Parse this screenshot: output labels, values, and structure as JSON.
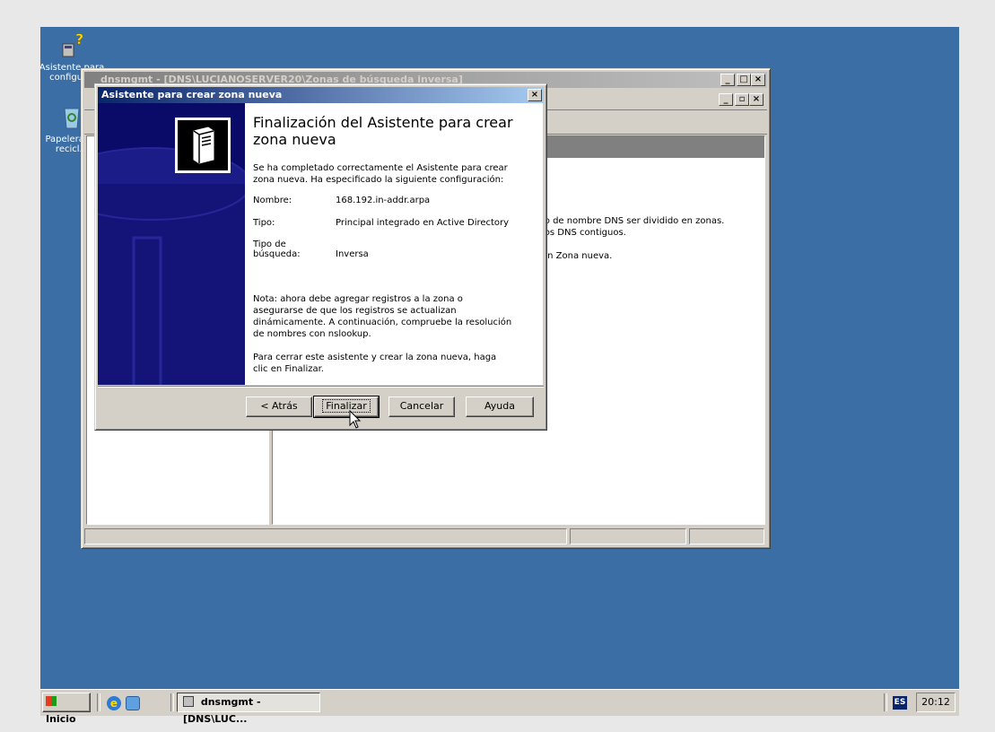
{
  "desktop": {
    "icons": [
      {
        "label": "Asistente para configur...",
        "icon": "wizard-icon"
      },
      {
        "label": "Papelera de recicl...",
        "icon": "recycle-bin-icon"
      }
    ]
  },
  "mmc": {
    "title": "dnsmgmt - [DNS\\LUCIANOSERVER20\\Zonas de búsqueda inversa]",
    "right_text": [
      "io de nombre DNS ser dividido en zonas.",
      "ios DNS contiguos.",
      "en Zona nueva."
    ]
  },
  "wizard": {
    "title": "Asistente para crear zona nueva",
    "heading": "Finalización del Asistente para crear zona nueva",
    "intro": "Se ha completado correctamente el Asistente para crear zona nueva. Ha especificado la siguiente configuración:",
    "fields": [
      {
        "label": "Nombre:",
        "value": "168.192.in-addr.arpa"
      },
      {
        "label": "Tipo:",
        "value": "Principal integrado en Active Directory"
      },
      {
        "label": "Tipo de búsqueda:",
        "value": "Inversa"
      }
    ],
    "note": "Nota: ahora debe agregar registros a la zona o asegurarse de que los registros se actualizan dinámicamente. A continuación, compruebe la resolución de nombres con nslookup.",
    "closing": "Para cerrar este asistente y crear la zona nueva, haga clic en Finalizar.",
    "buttons": {
      "back": "< Atrás",
      "finish": "Finalizar",
      "cancel": "Cancelar",
      "help": "Ayuda"
    }
  },
  "taskbar": {
    "start": "Inicio",
    "task": "dnsmgmt - [DNS\\LUC...",
    "lang": "ES",
    "clock": "20:12"
  }
}
